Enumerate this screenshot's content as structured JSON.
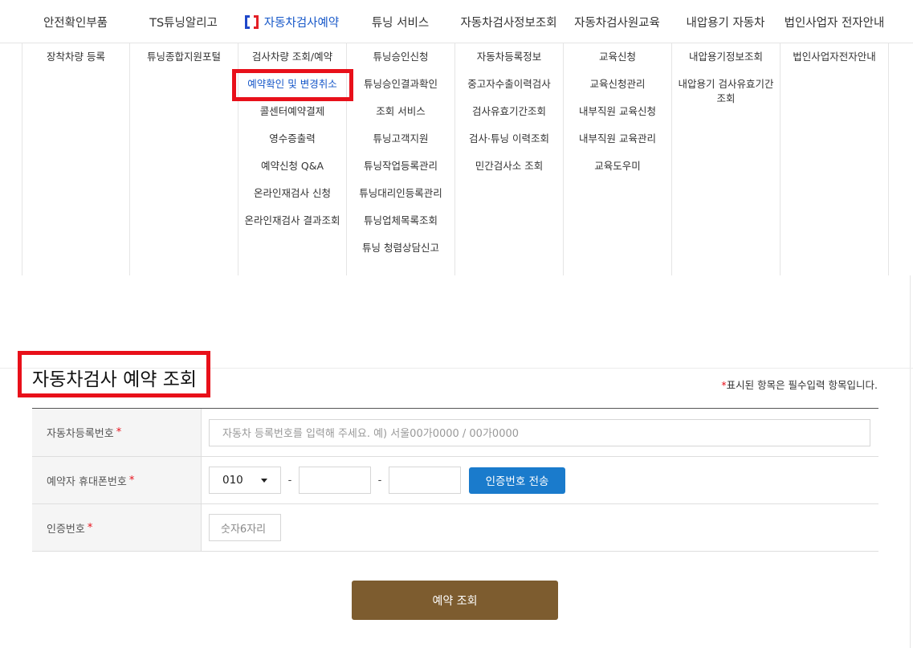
{
  "nav": {
    "tabs": [
      {
        "label": "안전확인부품"
      },
      {
        "label": "TS튜닝알리고"
      },
      {
        "label": "자동차검사예약"
      },
      {
        "label": "튜닝 서비스"
      },
      {
        "label": "자동차검사정보조회"
      },
      {
        "label": "자동차검사원교육"
      },
      {
        "label": "내압용기 자동차"
      },
      {
        "label": "법인사업자 전자안내"
      }
    ],
    "active_tab_index": 2,
    "brand_colors": {
      "left": "#1f48c9",
      "right": "#e31f26"
    }
  },
  "menu": {
    "col0": [
      "장착차량 등록"
    ],
    "col1": [
      "튜닝종합지원포털"
    ],
    "col2": [
      "검사차량 조회/예약",
      "예약확인 및 변경취소",
      "콜센터예약결제",
      "영수증출력",
      "예약신청 Q&A",
      "온라인재검사 신청",
      "온라인재검사 결과조회"
    ],
    "col3": [
      "튜닝승인신청",
      "튜닝승인결과확인",
      "조회 서비스",
      "튜닝고객지원",
      "튜닝작업등록관리",
      "튜닝대리인등록관리",
      "튜닝업체목록조회",
      "튜닝 청렴상담신고"
    ],
    "col4": [
      "자동차등록정보",
      "중고자수출이력검사",
      "검사유효기간조회",
      "검사·튜닝 이력조회",
      "민간검사소 조회"
    ],
    "col5": [
      "교육신청",
      "교육신청관리",
      "내부직원 교육신청",
      "내부직원 교육관리",
      "교육도우미"
    ],
    "col6": [
      "내압용기정보조회",
      "내압용기 검사유효기간 조회"
    ],
    "col7": [
      "법인사업자전자안내"
    ],
    "highlighted": "예약확인 및 변경취소"
  },
  "page": {
    "title": "자동차검사 예약 조회",
    "required_star": "*",
    "required_note": "표시된 항목은 필수입력 항목입니다."
  },
  "form": {
    "reg_label": "자동차등록번호",
    "reg_placeholder": "자동차 등록번호를 입력해 주세요. 예) 서울00가0000 / 00가0000",
    "phone_label": "예약자 휴대폰번호",
    "phone_prefix": "010",
    "dash": "-",
    "send_button": "인증번호 전송",
    "code_label": "인증번호",
    "code_placeholder": "숫자6자리",
    "star": "*"
  },
  "submit_label": "예약 조회",
  "colors": {
    "accent_blue": "#1a7bcc",
    "submit_brown": "#7d5c2f",
    "highlight_red": "#e8101a",
    "active_text": "#1657c8"
  }
}
